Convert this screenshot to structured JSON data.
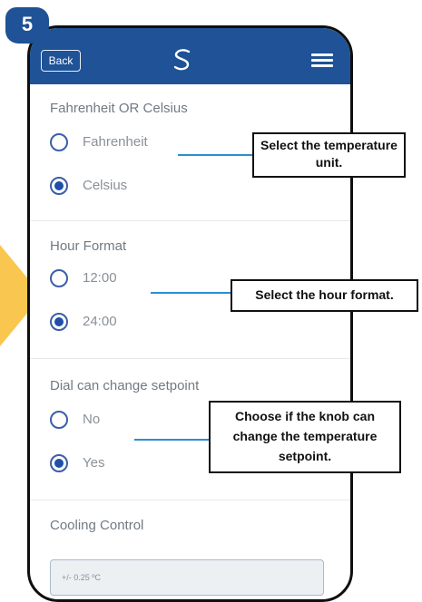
{
  "step_badge": "5",
  "header": {
    "back_label": "Back",
    "logo_icon": "salus-s-logo",
    "menu_icon": "hamburger-menu"
  },
  "sections": {
    "unit": {
      "title": "Fahrenheit OR Celsius",
      "opt1": "Fahrenheit",
      "opt2": "Celsius",
      "selected": "Celsius"
    },
    "hour": {
      "title": "Hour Format",
      "opt1": "12:00",
      "opt2": "24:00",
      "selected": "24:00"
    },
    "dial": {
      "title": "Dial can change setpoint",
      "opt1": "No",
      "opt2": "Yes",
      "selected": "Yes"
    },
    "cooling": {
      "title": "Cooling Control",
      "value": "+/- 0.25 ºC"
    }
  },
  "callouts": {
    "unit": "Select the temperature unit.",
    "hour": "Select the hour format.",
    "dial": "Choose if the knob can change the temperature setpoint."
  },
  "colors": {
    "header": "#1f5296",
    "radio": "#1f4fa6",
    "callout_line": "#2a8fd0",
    "arrow": "#f9c74f"
  }
}
